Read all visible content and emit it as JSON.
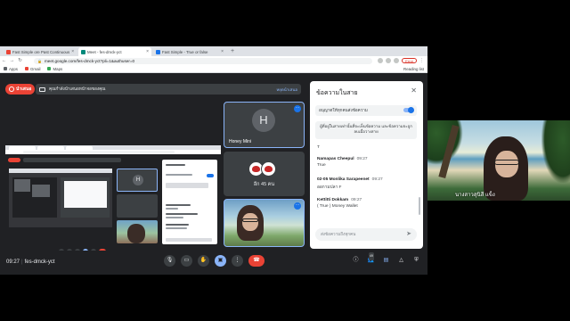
{
  "browser": {
    "tabs": [
      {
        "label": "Fast Simple ore Past Continuous",
        "color": "#ea4335",
        "active": false
      },
      {
        "label": "Meet - fes-dmck-yct",
        "color": "#00897b",
        "active": true
      },
      {
        "label": "Fast Simple - True or false",
        "color": "#1a73e8",
        "active": false
      }
    ],
    "new_tab": "+",
    "tab_close": "×",
    "url": "meet.google.com/fes-dmck-yct?pli=1&authuser=0",
    "error_label": "Error",
    "bookmarks": [
      {
        "label": "Apps",
        "color": "#5f6368"
      },
      {
        "label": "Gmail",
        "color": "#ea4335"
      },
      {
        "label": "Maps",
        "color": "#34a853"
      }
    ],
    "reading_list": "Reading list"
  },
  "meet": {
    "present_label": "นำเสนอ",
    "presenting_bar": "คุณกำลังนำเสนอหน้าจอของคุณ",
    "stop_label": "หยุดนำเสนอ",
    "tile_honey": {
      "initial": "H",
      "name": "Honey Mini"
    },
    "tile_more": {
      "label": "อีก 45 คน"
    },
    "shared_tile_initial": "H",
    "shared_clock": "09:27  fes-dmck-yct"
  },
  "chat": {
    "title": "ข้อความในสาย",
    "option": "อนุญาตให้ทุกคนส่งข้อความ",
    "notice": "ผู้ที่อยู่ในสายเท่านั้นที่จะเห็นข้อความ และข้อความจะถูกลบเมื่อวางสาย",
    "stray": "T",
    "messages": [
      {
        "sender": "Namapas Cheepul",
        "time": "09:27",
        "text": "True"
      },
      {
        "sender": "02-05 Monlika Sarapeenet",
        "time": "09:27",
        "text": "ออกามปลา F"
      },
      {
        "sender": "Kettitti Dokkam",
        "time": "09:27",
        "text": "( True ) Money Wallet"
      }
    ],
    "input_placeholder": "ส่งข้อความถึงทุกคน"
  },
  "bottom": {
    "time": "09:27",
    "meeting_code": "fes-dmck-yct",
    "participants_count": "49"
  },
  "webcam": {
    "name": "นางสาวสุนิสี แข็ง"
  }
}
